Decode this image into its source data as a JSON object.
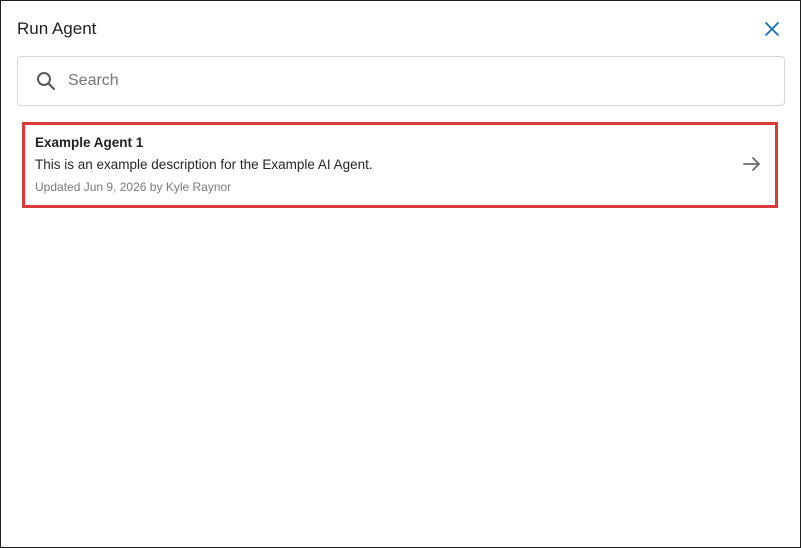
{
  "dialog": {
    "title": "Run Agent",
    "close_label": "Close",
    "accent_color": "#1a6fb5"
  },
  "search": {
    "placeholder": "Search",
    "value": ""
  },
  "agents": [
    {
      "name": "Example Agent 1",
      "description": "This is an example description for the Example AI Agent.",
      "updated_prefix": "Updated",
      "updated_date": "Jun 9, 2026",
      "by_label": "by",
      "author": "Kyle Raynor",
      "highlight_color": "#d93a3a"
    }
  ],
  "icons": {
    "close": "close-icon",
    "search": "search-icon",
    "open": "arrow-right-icon"
  }
}
